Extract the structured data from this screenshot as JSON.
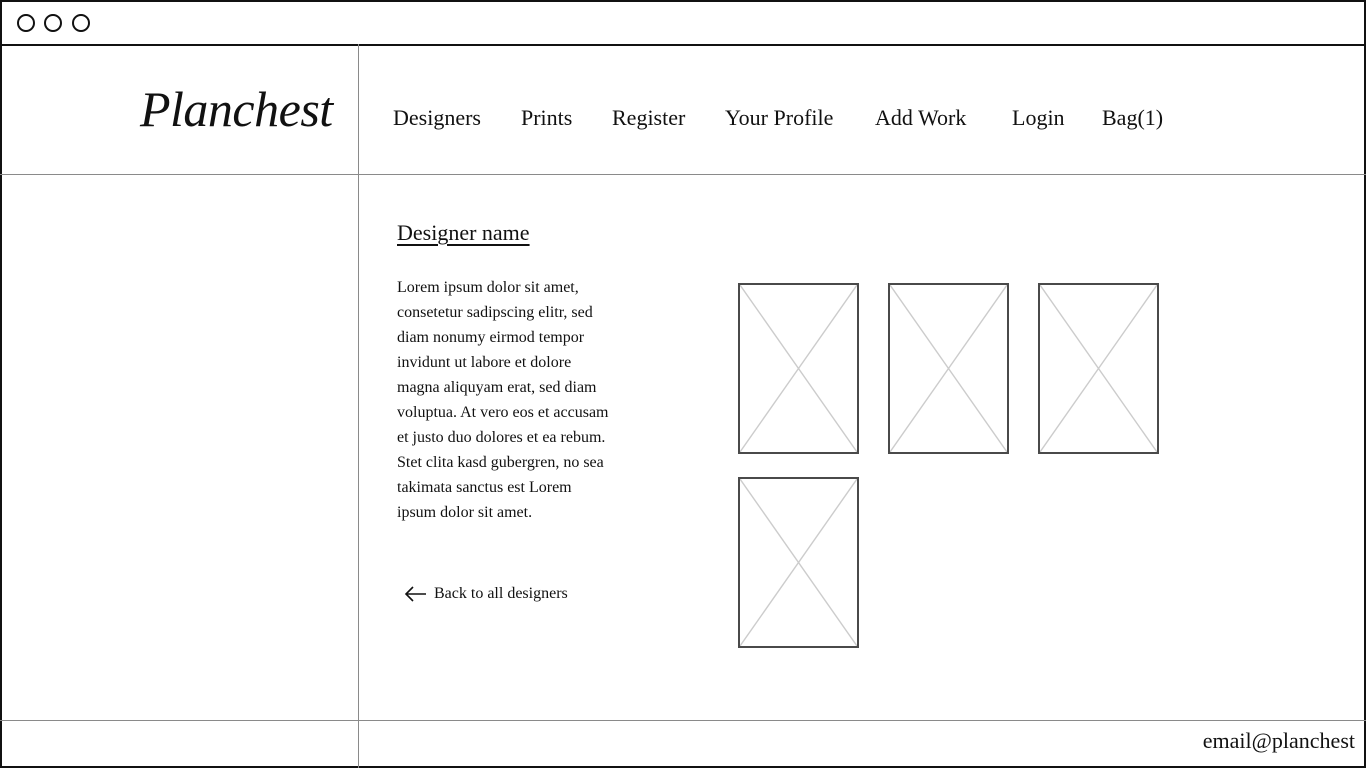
{
  "window": {
    "controls": [
      "circle-icon",
      "circle-icon",
      "circle-icon"
    ]
  },
  "header": {
    "logo": "Planchest",
    "nav": [
      {
        "label": "Designers"
      },
      {
        "label": "Prints"
      },
      {
        "label": "Register"
      },
      {
        "label": "Your Profile"
      },
      {
        "label": "Add Work"
      },
      {
        "label": "Login"
      },
      {
        "label": "Bag(1)"
      }
    ]
  },
  "main": {
    "designer_name": "Designer name",
    "bio": "Lorem ipsum dolor sit amet, consetetur sadipscing elitr, sed diam nonumy eirmod tempor invidunt ut labore et dolore magna aliquyam erat, sed diam voluptua. At vero eos et accusam et justo duo dolores et ea rebum. Stet clita kasd gubergren, no sea takimata sanctus est Lorem ipsum dolor sit amet.",
    "back_link": "Back to all designers",
    "back_icon": "arrow-left-icon",
    "works_count": 4,
    "work_placeholder_icon": "image-placeholder-icon"
  },
  "footer": {
    "email": "email@planchest"
  },
  "colors": {
    "border": "#111111",
    "divider": "#8a8a8a",
    "placeholder_cross": "#cccccc",
    "thumb_border": "#4a4a4a"
  }
}
